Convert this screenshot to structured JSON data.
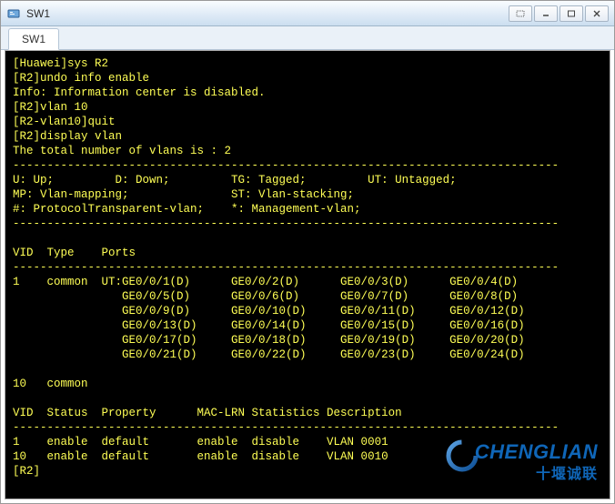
{
  "window": {
    "title": "SW1"
  },
  "tabs": [
    {
      "label": "SW1"
    }
  ],
  "terminal": {
    "lines": [
      "[Huawei]sys R2",
      "[R2]undo info enable",
      "Info: Information center is disabled.",
      "[R2]vlan 10",
      "[R2-vlan10]quit",
      "[R2]display vlan",
      "The total number of vlans is : 2"
    ],
    "dash": "--------------------------------------------------------------------------------",
    "legend": [
      "U: Up;         D: Down;         TG: Tagged;         UT: Untagged;",
      "MP: Vlan-mapping;               ST: Vlan-stacking;",
      "#: ProtocolTransparent-vlan;    *: Management-vlan;"
    ],
    "ports_header": "VID  Type    Ports",
    "ports_rows": [
      "1    common  UT:GE0/0/1(D)      GE0/0/2(D)      GE0/0/3(D)      GE0/0/4(D)",
      "                GE0/0/5(D)      GE0/0/6(D)      GE0/0/7(D)      GE0/0/8(D)",
      "                GE0/0/9(D)      GE0/0/10(D)     GE0/0/11(D)     GE0/0/12(D)",
      "                GE0/0/13(D)     GE0/0/14(D)     GE0/0/15(D)     GE0/0/16(D)",
      "                GE0/0/17(D)     GE0/0/18(D)     GE0/0/19(D)     GE0/0/20(D)",
      "                GE0/0/21(D)     GE0/0/22(D)     GE0/0/23(D)     GE0/0/24(D)",
      "",
      "10   common"
    ],
    "status_header": "VID  Status  Property      MAC-LRN Statistics Description",
    "status_rows": [
      "1    enable  default       enable  disable    VLAN 0001",
      "10   enable  default       enable  disable    VLAN 0010"
    ],
    "prompt": "[R2]"
  },
  "watermark": {
    "en": "CHENGLIAN",
    "cn": "十堰诚联"
  }
}
